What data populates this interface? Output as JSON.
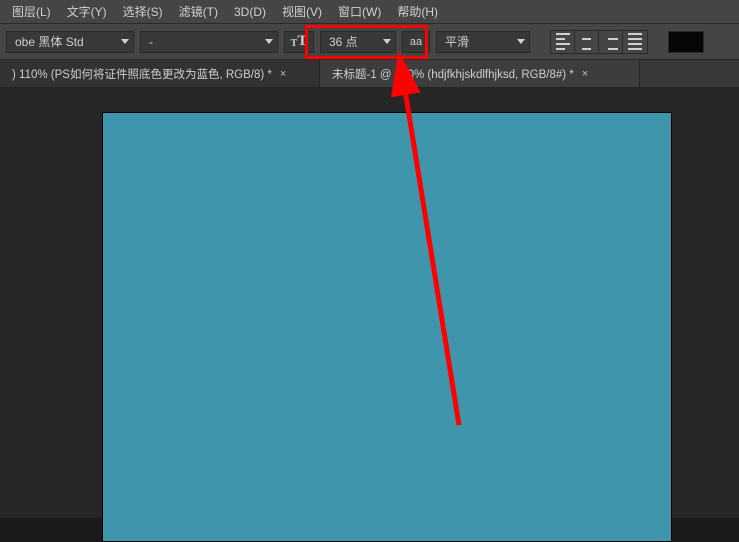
{
  "menubar": {
    "items": [
      {
        "label": "图层(L)"
      },
      {
        "label": "文字(Y)"
      },
      {
        "label": "选择(S)"
      },
      {
        "label": "滤镜(T)"
      },
      {
        "label": "3D(D)"
      },
      {
        "label": "视图(V)"
      },
      {
        "label": "窗口(W)"
      },
      {
        "label": "帮助(H)"
      }
    ]
  },
  "options": {
    "font_family": "obe 黑体 Std",
    "font_style": "-",
    "size_icon": "tT",
    "font_size": "36 点",
    "aa_icon": "aa",
    "aa_mode": "平滑"
  },
  "tabs": [
    {
      "label": ") 110% (PS如何将证件照底色更改为蓝色, RGB/8) *",
      "active": false
    },
    {
      "label": "未标题-1 @ 100% (hdjfkhjskdlfhjksd, RGB/8#) *",
      "active": true
    }
  ],
  "colors": {
    "canvas_fill": "#3f95ab",
    "annotation": "#ff0000"
  }
}
